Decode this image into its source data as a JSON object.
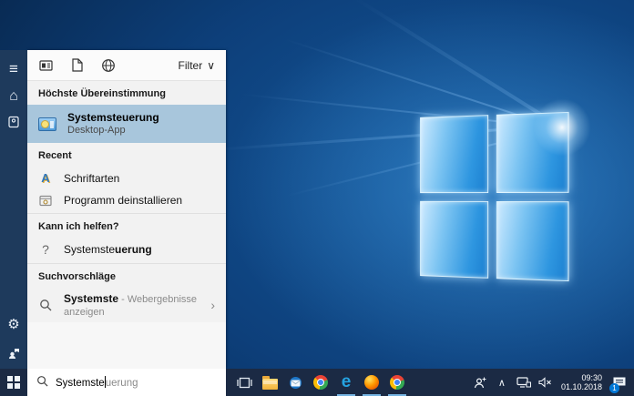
{
  "panel": {
    "filter_label": "Filter",
    "best_match_header": "Höchste Übereinstimmung",
    "best_match": {
      "title": "Systemsteuerung",
      "subtitle": "Desktop-App"
    },
    "recent_header": "Recent",
    "recent_items": [
      {
        "label": "Schriftarten"
      },
      {
        "label": "Programm deinstallieren"
      }
    ],
    "help_header": "Kann ich helfen?",
    "help_item": {
      "typed": "Systemste",
      "completion": "uerung"
    },
    "suggestions_header": "Suchvorschläge",
    "suggestion": {
      "query": "Systemste",
      "rest": " - Webergebnisse anzeigen"
    }
  },
  "searchbox": {
    "typed": "Systemste",
    "completion": "uerung"
  },
  "taskbar": {
    "time": "09:30",
    "date": "01.10.2018",
    "notification_count": "1"
  },
  "glyphs": {
    "hamburger": "≡",
    "home": "⌂",
    "gear": "⚙",
    "fonts_letter": "A",
    "question": "?",
    "filter_chevron": "∨",
    "suggestion_chevron": "›",
    "tray_chevron": "∧"
  },
  "colors": {
    "accent": "#0078d7",
    "rail": "#1e3a5c",
    "taskbar": "#1b2a44",
    "highlight_row": "#a8c6dc",
    "panel_bg": "#f2f2f2"
  }
}
